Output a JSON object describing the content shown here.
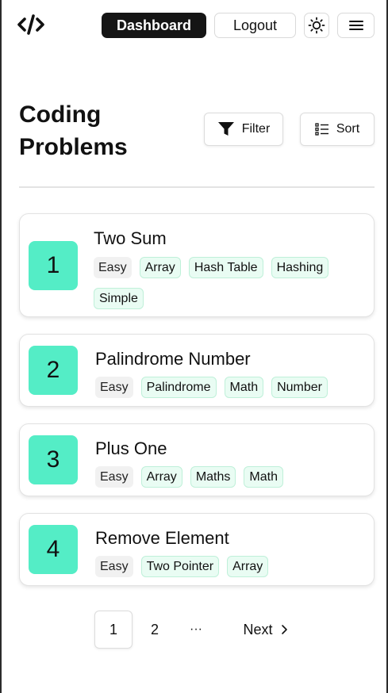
{
  "header": {
    "logo_icon": "code-icon",
    "dashboard_label": "Dashboard",
    "logout_label": "Logout",
    "theme_icon": "sun-icon",
    "menu_icon": "hamburger-icon"
  },
  "page": {
    "title_line1": "Coding",
    "title_line2": "Problems",
    "filter_label": "Filter",
    "sort_label": "Sort",
    "accent_color": "#54edc6"
  },
  "problems": [
    {
      "number": "1",
      "title": "Two Sum",
      "difficulty": "Easy",
      "tags": [
        "Array",
        "Hash Table",
        "Hashing",
        "Simple"
      ]
    },
    {
      "number": "2",
      "title": "Palindrome Number",
      "difficulty": "Easy",
      "tags": [
        "Palindrome",
        "Math",
        "Number"
      ]
    },
    {
      "number": "3",
      "title": "Plus One",
      "difficulty": "Easy",
      "tags": [
        "Array",
        "Maths",
        "Math"
      ]
    },
    {
      "number": "4",
      "title": "Remove Element",
      "difficulty": "Easy",
      "tags": [
        "Two Pointer",
        "Array"
      ]
    }
  ],
  "pagination": {
    "pages": [
      "1",
      "2"
    ],
    "ellipsis": "···",
    "next_label": "Next",
    "current": "1"
  }
}
